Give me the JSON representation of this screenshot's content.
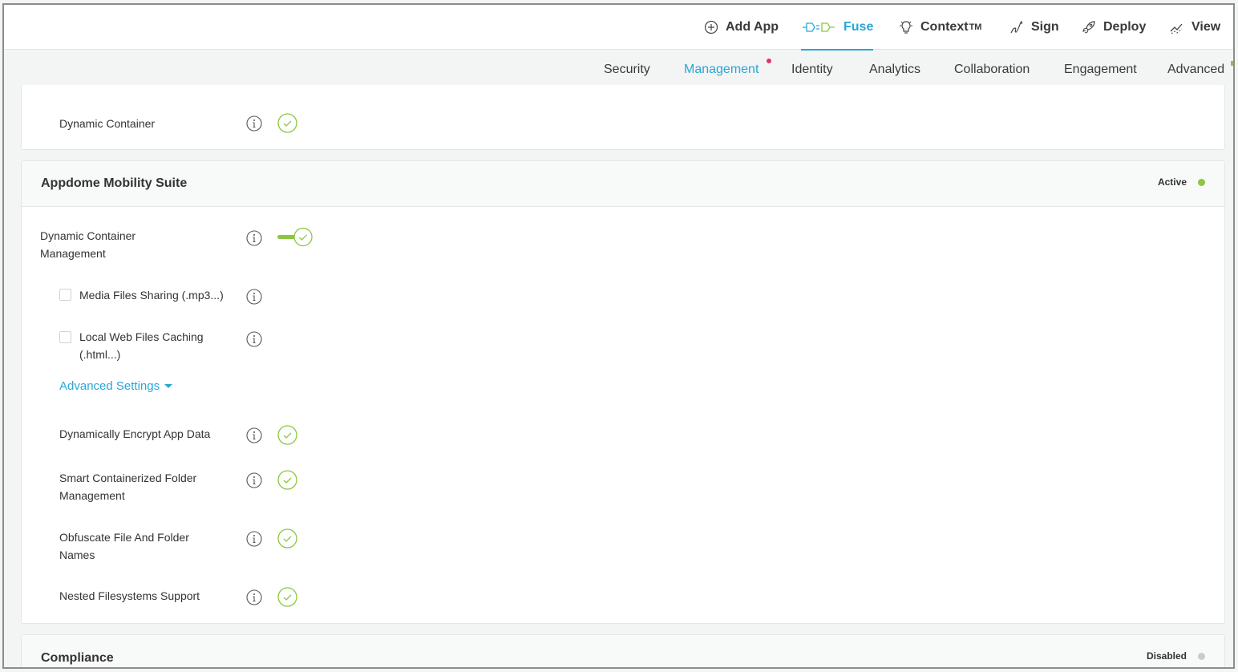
{
  "topnav": {
    "add_app": "Add App",
    "fuse": "Fuse",
    "context": "Context",
    "context_sup": "TM",
    "sign": "Sign",
    "deploy": "Deploy",
    "view": "View"
  },
  "subnav": {
    "items": [
      "Security",
      "Management",
      "Identity",
      "Analytics",
      "Collaboration",
      "Engagement",
      "Advanced"
    ],
    "active": "Management"
  },
  "cards": {
    "top": {
      "rows": [
        {
          "label": "Dynamic Container",
          "enabled": true
        }
      ]
    },
    "mobility": {
      "title": "Appdome Mobility Suite",
      "status": "Active",
      "status_color": "#8dc63f",
      "main_toggle_line1": "Dynamic Container",
      "main_toggle_line2": "Management",
      "options": [
        {
          "label": "Media Files Sharing (.mp3...)",
          "checked": false
        },
        {
          "label_line1": "Local Web Files Caching",
          "label_line2": "(.html...)",
          "checked": false
        }
      ],
      "advanced_settings": "Advanced Settings",
      "features": [
        {
          "label": "Dynamically Encrypt App Data"
        },
        {
          "label_line1": "Smart Containerized Folder",
          "label_line2": "Management"
        },
        {
          "label_line1": "Obfuscate File And Folder",
          "label_line2": "Names"
        },
        {
          "label": "Nested Filesystems Support"
        }
      ]
    },
    "compliance": {
      "title": "Compliance",
      "status": "Disabled",
      "status_color": "#c8cccc"
    }
  },
  "colors": {
    "accent": "#2aa6d6",
    "check": "#8dc63f",
    "notify": "#e0356b"
  },
  "icons": [
    "add-circle-icon",
    "fuse-plug-icon",
    "lightbulb-icon",
    "signature-icon",
    "rocket-icon",
    "chart-line-icon",
    "info-icon",
    "check-circle-icon",
    "toggle-icon",
    "caret-down-icon"
  ]
}
